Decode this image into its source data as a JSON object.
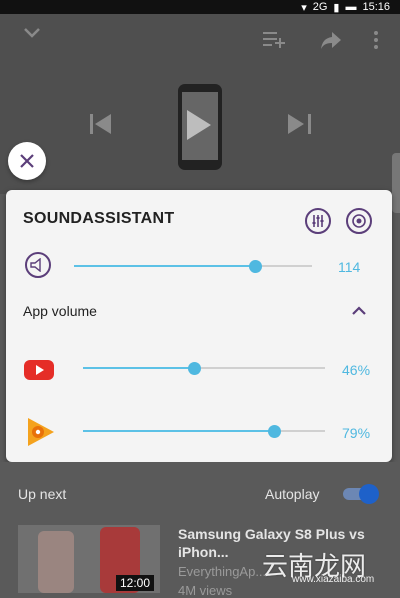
{
  "status_bar": {
    "network": "2G",
    "time": "15:16"
  },
  "colors": {
    "accent_purple": "#5b3e7a",
    "slider_blue": "#4fb8e0",
    "youtube_red": "#e52d27",
    "play_music_orange": "#f4a21d"
  },
  "icons": {
    "collapse": "chevron-down-icon",
    "add_to_playlist": "playlist-add-icon",
    "share": "share-icon",
    "more": "more-vert-icon",
    "previous": "skip-previous-icon",
    "play": "play-icon",
    "next": "skip-next-icon",
    "close": "close-icon",
    "equalizer": "equalizer-icon",
    "settings": "sound-settings-icon",
    "speaker": "speaker-icon",
    "chevron_up": "chevron-up-icon"
  },
  "sound_assistant": {
    "title": "SOUNDASSISTANT",
    "master_volume": {
      "value": 0.76,
      "label": "114"
    },
    "app_volume_label": "App volume",
    "apps": [
      {
        "name": "YouTube",
        "icon": "youtube-icon",
        "level": 0.46,
        "label": "46%"
      },
      {
        "name": "Play Music",
        "icon": "play-music-icon",
        "level": 0.79,
        "label": "79%"
      }
    ]
  },
  "up_next": {
    "label": "Up next",
    "autoplay_label": "Autoplay",
    "autoplay_on": true,
    "video": {
      "duration": "12:00",
      "title": "Samsung Galaxy S8 Plus vs iPhon...",
      "channel": "EverythingAp...",
      "views": "4M views"
    }
  },
  "watermark": {
    "text": "云南龙网",
    "sub": "www.xiazaiba.com"
  }
}
